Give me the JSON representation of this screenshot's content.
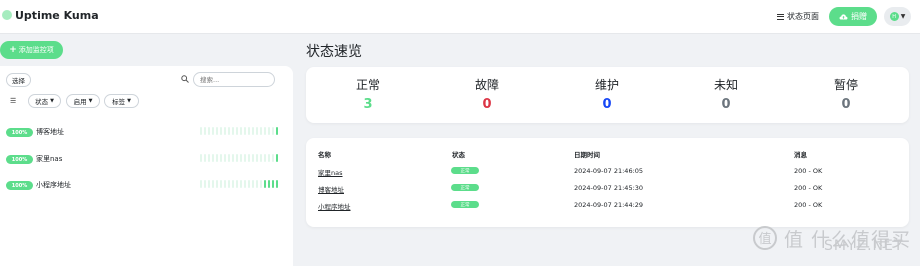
{
  "header": {
    "app_title": "Uptime Kuma",
    "status_page_label": "状态页面",
    "sponsor_label": "捐赠",
    "profile_initial": "H"
  },
  "sidebar": {
    "add_monitor_label": "添加监控项",
    "select_label": "选择",
    "search_placeholder": "搜索...",
    "filters": {
      "status": "状态",
      "active": "启用",
      "tags": "标签"
    },
    "monitors": [
      {
        "uptime": "100%",
        "name": "博客地址",
        "beats_up": 1
      },
      {
        "uptime": "100%",
        "name": "家里nas",
        "beats_up": 1
      },
      {
        "uptime": "100%",
        "name": "小程序地址",
        "beats_up": 4
      }
    ]
  },
  "overview": {
    "title": "状态速览",
    "stats": [
      {
        "label": "正常",
        "value": "3",
        "color": "#5cdd8b"
      },
      {
        "label": "故障",
        "value": "0",
        "color": "#dc3545"
      },
      {
        "label": "维护",
        "value": "0",
        "color": "#1747f5"
      },
      {
        "label": "未知",
        "value": "0",
        "color": "#6c757d"
      },
      {
        "label": "暂停",
        "value": "0",
        "color": "#6c757d"
      }
    ]
  },
  "events": {
    "headers": {
      "name": "名称",
      "status": "状态",
      "datetime": "日期时间",
      "message": "消息"
    },
    "rows": [
      {
        "name": "家里nas",
        "status": "正常",
        "datetime": "2024-09-07 21:46:05",
        "message": "200 - OK"
      },
      {
        "name": "博客地址",
        "status": "正常",
        "datetime": "2024-09-07 21:45:30",
        "message": "200 - OK"
      },
      {
        "name": "小程序地址",
        "status": "正常",
        "datetime": "2024-09-07 21:44:29",
        "message": "200 - OK"
      }
    ]
  },
  "watermark": {
    "text": "值 什么值得买",
    "domain": "SMYZ.NET"
  }
}
